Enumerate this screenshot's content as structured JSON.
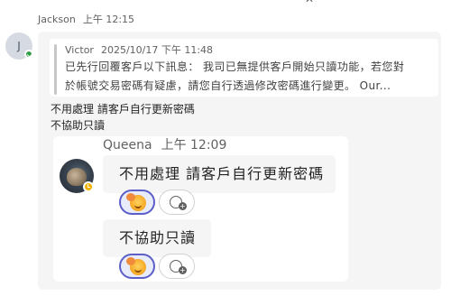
{
  "top_partial_icon": "dismiss-icon",
  "sender": {
    "name": "Jackson",
    "time": "上午 12:15",
    "avatar_initial": "J",
    "presence": "available"
  },
  "quote": {
    "author": "Victor",
    "timestamp": "2025/10/17 下午 11:48",
    "lines": [
      "已先行回覆客戶以下訊息： 我司已無提供客戶開始只讀功能，若您對",
      "於帳號交易密碼有疑慮，請您自行透過修改密碼進行變更。 Our..."
    ]
  },
  "messages": [
    "不用處理 請客戶自行更新密碼",
    "不協助只讀"
  ],
  "embedded": {
    "author": "Queena",
    "time": "上午 12:09",
    "presence": "away",
    "messages": [
      {
        "text": "不用處理 請客戶自行更新密碼",
        "reaction_icon": "laughing-emoji-icon",
        "add_reaction_icon": "add-emoji-icon"
      },
      {
        "text": "不協助只讀",
        "reaction_icon": "laughing-emoji-icon",
        "add_reaction_icon": "add-emoji-icon"
      }
    ]
  },
  "colors": {
    "accent": "#5b5fc7",
    "bubble": "#f5f5f5",
    "available": "#2f9e44",
    "away": "#f2b200"
  }
}
